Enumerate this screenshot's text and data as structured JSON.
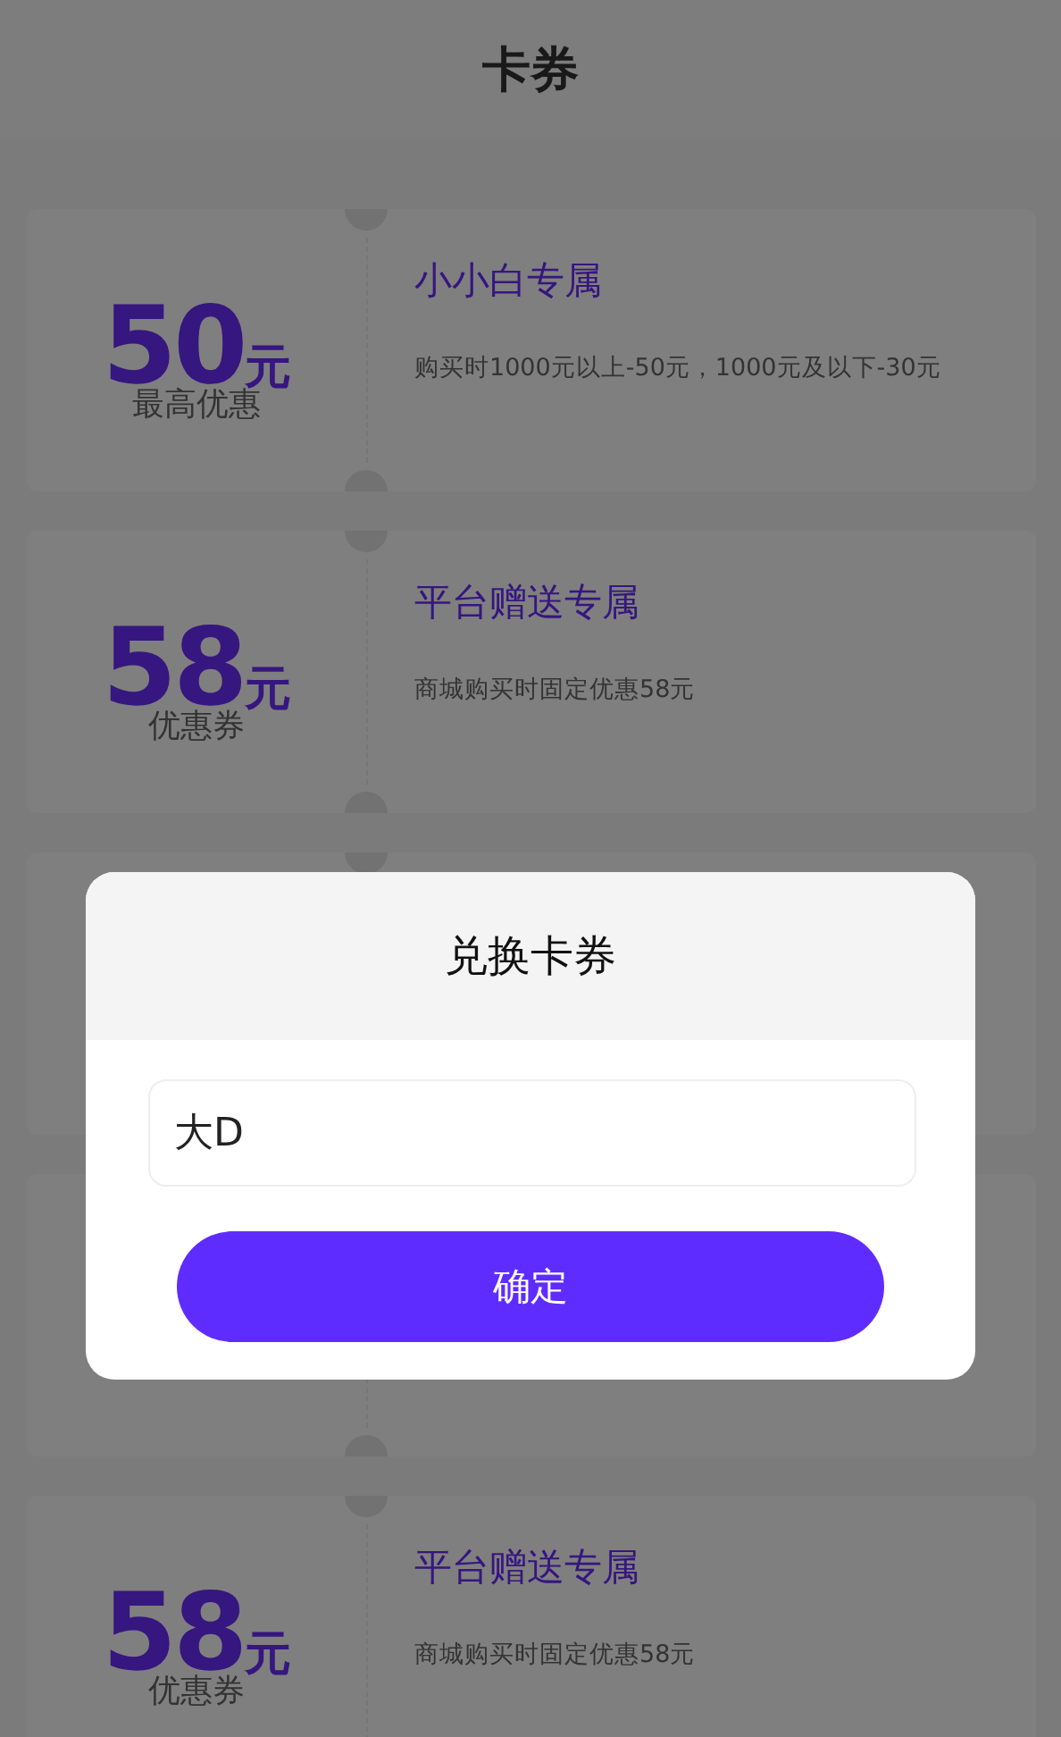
{
  "header": {
    "title": "卡券"
  },
  "coupons": [
    {
      "kind": "full",
      "amount": "50",
      "unit": "元",
      "label": "最高优惠",
      "title": "小小白专属",
      "description": "购买时1000元以上-50元，1000元及以下-30元"
    },
    {
      "kind": "full",
      "amount": "58",
      "unit": "元",
      "label": "优惠券",
      "title": "平台赠送专属",
      "description": "商城购买时固定优惠58元"
    },
    {
      "kind": "covered"
    },
    {
      "kind": "covered"
    },
    {
      "kind": "full",
      "amount": "58",
      "unit": "元",
      "label": "优惠券",
      "title": "平台赠送专属",
      "description": "商城购买时固定优惠58元"
    }
  ],
  "dialog": {
    "title": "兑换卡券",
    "input": {
      "value": "大D"
    },
    "confirm_button": "确定"
  }
}
